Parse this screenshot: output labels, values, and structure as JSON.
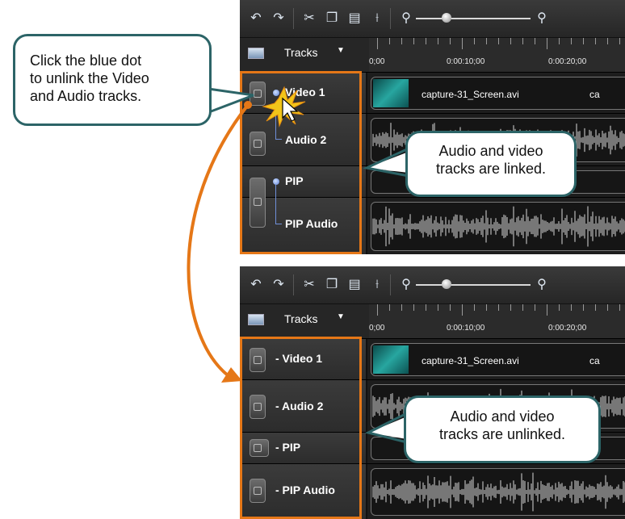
{
  "callout_top": {
    "text": "Click the blue dot to unlink the Video and Audio tracks.",
    "lines": [
      "Click the blue dot",
      "to unlink the Video",
      "and Audio tracks."
    ]
  },
  "callout_linked": {
    "lines": [
      "Audio and video",
      "tracks are linked."
    ]
  },
  "callout_unlinked": {
    "lines": [
      "Audio and video",
      "tracks are unlinked."
    ]
  },
  "toolbar": {
    "icons": [
      "undo-icon",
      "redo-icon",
      "cut-icon",
      "copy-icon",
      "paste-icon",
      "split-icon",
      "zoom-out-icon",
      "zoom-slider",
      "zoom-in-icon"
    ],
    "tracks_label": "Tracks"
  },
  "ruler": {
    "labels": [
      "0;00",
      "0:00:10;00",
      "0:00:20;00"
    ]
  },
  "linked_panel": {
    "tracks": [
      {
        "name": "Video 1",
        "type": "video",
        "clip": "capture-31_Screen.avi",
        "clip_trail": "ca"
      },
      {
        "name": "Audio 2",
        "type": "audio"
      },
      {
        "name": "PIP",
        "type": "empty"
      },
      {
        "name": "PIP Audio",
        "type": "audio"
      }
    ]
  },
  "unlinked_panel": {
    "tracks": [
      {
        "name": "- Video 1",
        "type": "video",
        "clip": "capture-31_Screen.avi",
        "clip_trail": "ca"
      },
      {
        "name": "- Audio 2",
        "type": "audio"
      },
      {
        "name": "- PIP",
        "type": "empty"
      },
      {
        "name": "- PIP Audio",
        "type": "audio"
      }
    ]
  },
  "colors": {
    "highlight": "#e57717",
    "callout_border": "#2c6467",
    "link_dot": "#5b7fd6",
    "panel_bg": "#2a2a2a"
  }
}
